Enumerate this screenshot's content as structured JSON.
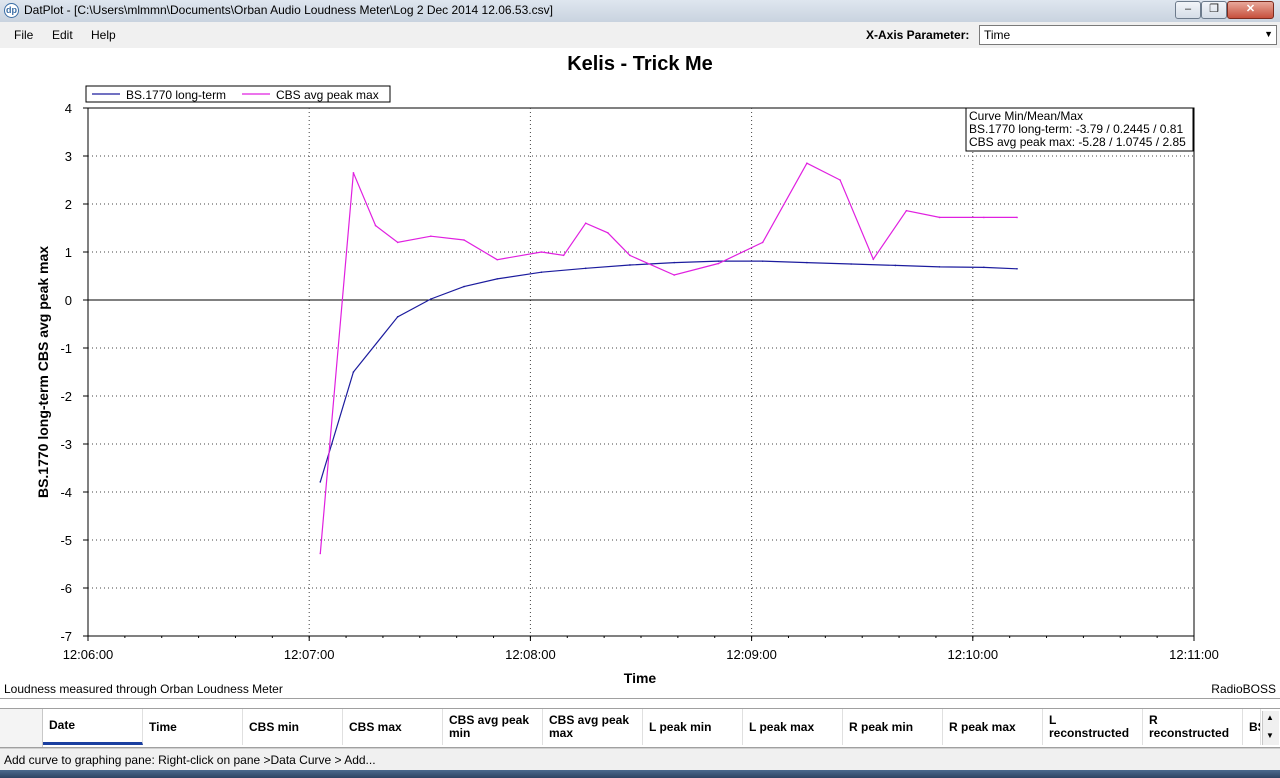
{
  "window": {
    "title": "DatPlot - [C:\\Users\\mlmmn\\Documents\\Orban Audio Loudness Meter\\Log 2 Dec 2014 12.06.53.csv]",
    "minimize_glyph": "‒",
    "maximize_glyph": "❐",
    "close_glyph": "✕"
  },
  "menu": {
    "file": "File",
    "edit": "Edit",
    "help": "Help"
  },
  "xaxis_param": {
    "label": "X-Axis Parameter:",
    "value": "Time"
  },
  "chart_data": {
    "type": "line",
    "title": "Kelis - Trick Me",
    "xlabel": "Time",
    "ylabel": "BS.1770 long-term CBS avg peak max",
    "xlim": [
      "12:06:00",
      "12:11:00"
    ],
    "xticks": [
      "12:06:00",
      "12:07:00",
      "12:08:00",
      "12:09:00",
      "12:10:00",
      "12:11:00"
    ],
    "ylim": [
      -7,
      4
    ],
    "yticks": [
      "4",
      "3",
      "2",
      "1",
      "0",
      "-1",
      "-2",
      "-3",
      "-4",
      "-5",
      "-6",
      "-7"
    ],
    "grid": true,
    "legend_position": "top-left",
    "series": [
      {
        "name": "BS.1770 long-term",
        "color": "#1c1c9e",
        "x": [
          "12:07:03",
          "12:07:12",
          "12:07:24",
          "12:07:33",
          "12:07:42",
          "12:07:51",
          "12:08:03",
          "12:08:15",
          "12:08:27",
          "12:08:39",
          "12:08:51",
          "12:09:03",
          "12:09:15",
          "12:09:27",
          "12:09:39",
          "12:09:51",
          "12:10:03",
          "12:10:12"
        ],
        "y": [
          -3.79,
          -1.5,
          -0.35,
          0.02,
          0.28,
          0.44,
          0.58,
          0.66,
          0.73,
          0.78,
          0.81,
          0.81,
          0.78,
          0.75,
          0.72,
          0.69,
          0.68,
          0.65
        ]
      },
      {
        "name": "CBS avg peak max",
        "color": "#e020e0",
        "x": [
          "12:07:03",
          "12:07:12",
          "12:07:18",
          "12:07:24",
          "12:07:33",
          "12:07:42",
          "12:07:51",
          "12:08:03",
          "12:08:09",
          "12:08:15",
          "12:08:21",
          "12:08:27",
          "12:08:39",
          "12:08:51",
          "12:09:03",
          "12:09:15",
          "12:09:24",
          "12:09:33",
          "12:09:42",
          "12:09:51",
          "12:10:03",
          "12:10:12"
        ],
        "y": [
          -5.28,
          2.65,
          1.55,
          1.2,
          1.33,
          1.25,
          0.84,
          1.0,
          0.93,
          1.6,
          1.4,
          0.93,
          0.52,
          0.76,
          1.2,
          2.85,
          2.5,
          0.85,
          1.86,
          1.72,
          1.72,
          1.72
        ]
      }
    ],
    "stats_box": {
      "title": "Curve Min/Mean/Max",
      "lines": [
        "BS.1770 long-term: -3.79 / 0.2445 / 0.81",
        "CBS avg peak max: -5.28 / 1.0745 / 2.85"
      ]
    }
  },
  "footer": {
    "left": "Loudness measured through Orban Loudness Meter",
    "right": "RadioBOSS"
  },
  "grid": {
    "columns": [
      "Date",
      "Time",
      "CBS min",
      "CBS max",
      "CBS avg peak min",
      "CBS avg peak max",
      "L peak min",
      "L peak max",
      "R peak min",
      "R peak max",
      "L reconstructed",
      "R reconstructed",
      "BS"
    ]
  },
  "status": {
    "text": "Add curve to graphing pane: Right-click on pane >Data Curve > Add..."
  }
}
